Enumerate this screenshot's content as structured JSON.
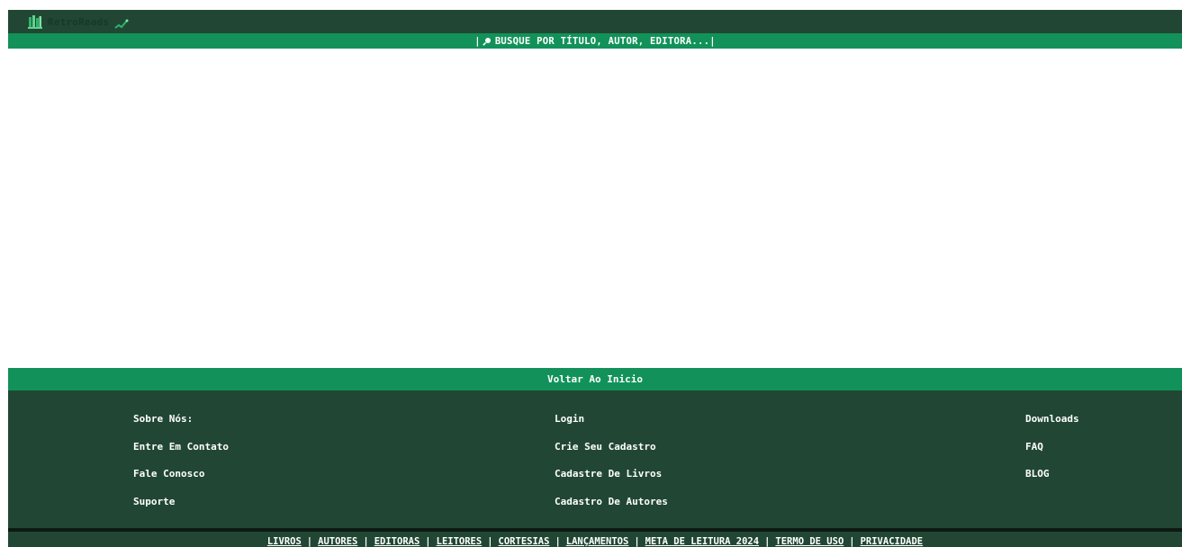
{
  "header": {
    "brand": "RetroReads",
    "logo_icon": "bookshelf-icon",
    "badge_icon": "sparkle-icon"
  },
  "search": {
    "placeholder": "🔎 BUSQUE POR TÍTULO, AUTOR, EDITORA...",
    "label": "BUSQUE POR TÍTULO, AUTOR, EDITORA..."
  },
  "back_to_top": "Voltar Ao Inicio",
  "footer": {
    "col1": [
      "Sobre Nós:",
      "Entre Em Contato",
      "Fale Conosco",
      "Suporte"
    ],
    "col2": [
      "Login",
      "Crie Seu Cadastro",
      "Cadastre De Livros",
      "Cadastro De Autores"
    ],
    "col3": [
      "Downloads",
      "FAQ",
      "BLOG"
    ]
  },
  "bottom_nav": [
    "LIVROS",
    "AUTORES",
    "EDITORAS",
    "LEITORES",
    "CORTESIAS",
    "LANÇAMENTOS",
    "META DE LEITURA 2024",
    "TERMO DE USO",
    "PRIVACIDADE"
  ],
  "colors": {
    "dark_green": "#214734",
    "accent_green": "#12925a"
  }
}
